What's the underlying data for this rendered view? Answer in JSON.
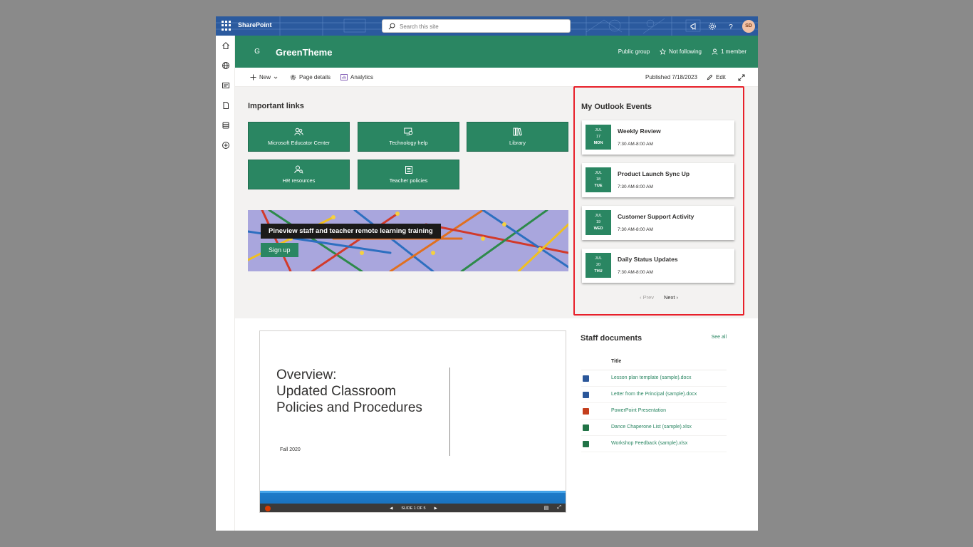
{
  "suite": {
    "brand": "SharePoint",
    "search_placeholder": "Search this site",
    "user_initials": "SD"
  },
  "site": {
    "logo_letter": "G",
    "title": "GreenTheme",
    "privacy": "Public group",
    "follow": "Not following",
    "members": "1 member"
  },
  "commandbar": {
    "new": "New",
    "page_details": "Page details",
    "analytics": "Analytics",
    "published": "Published 7/18/2023",
    "edit": "Edit"
  },
  "important_links": {
    "heading": "Important links",
    "items": [
      {
        "label": "Microsoft Educator Center",
        "icon": "people-icon"
      },
      {
        "label": "Technology help",
        "icon": "screen-settings-icon"
      },
      {
        "label": "Library",
        "icon": "books-icon"
      },
      {
        "label": "HR resources",
        "icon": "person-search-icon"
      },
      {
        "label": "Teacher policies",
        "icon": "clipboard-icon"
      }
    ]
  },
  "hero": {
    "title": "Pineview staff and teacher remote learning training",
    "button": "Sign up"
  },
  "events": {
    "heading": "My Outlook Events",
    "items": [
      {
        "month": "JUL",
        "day": "17",
        "weekday": "MON",
        "title": "Weekly Review",
        "time": "7:30 AM-8:00 AM"
      },
      {
        "month": "JUL",
        "day": "18",
        "weekday": "TUE",
        "title": "Product Launch Sync Up",
        "time": "7:30 AM-8:00 AM"
      },
      {
        "month": "JUL",
        "day": "19",
        "weekday": "WED",
        "title": "Customer Support Activity",
        "time": "7:30 AM-8:00 AM"
      },
      {
        "month": "JUL",
        "day": "20",
        "weekday": "THU",
        "title": "Daily Status Updates",
        "time": "7:30 AM-8:00 AM"
      }
    ],
    "prev": "Prev",
    "next": "Next"
  },
  "deck": {
    "title_line1": "Overview:",
    "title_line2": "Updated Classroom",
    "title_line3": "Policies and Procedures",
    "subtitle": "Fall 2020",
    "slide_indicator": "SLIDE 1 OF 5"
  },
  "documents": {
    "heading": "Staff documents",
    "see_all": "See all",
    "column_title": "Title",
    "items": [
      {
        "name": "Lesson plan template (sample).docx",
        "type": "word",
        "color": "#2b579a"
      },
      {
        "name": "Letter from the Principal (sample).docx",
        "type": "word",
        "color": "#2b579a"
      },
      {
        "name": "PowerPoint Presentation",
        "type": "powerpoint",
        "color": "#c43e1c"
      },
      {
        "name": "Dance Chaperone List (sample).xlsx",
        "type": "excel",
        "color": "#217346"
      },
      {
        "name": "Workshop Feedback (sample).xlsx",
        "type": "excel",
        "color": "#217346"
      }
    ]
  },
  "colors": {
    "theme_green": "#2a8662",
    "suite_blue": "#2b5a9e",
    "highlight_red": "#e8202a"
  }
}
